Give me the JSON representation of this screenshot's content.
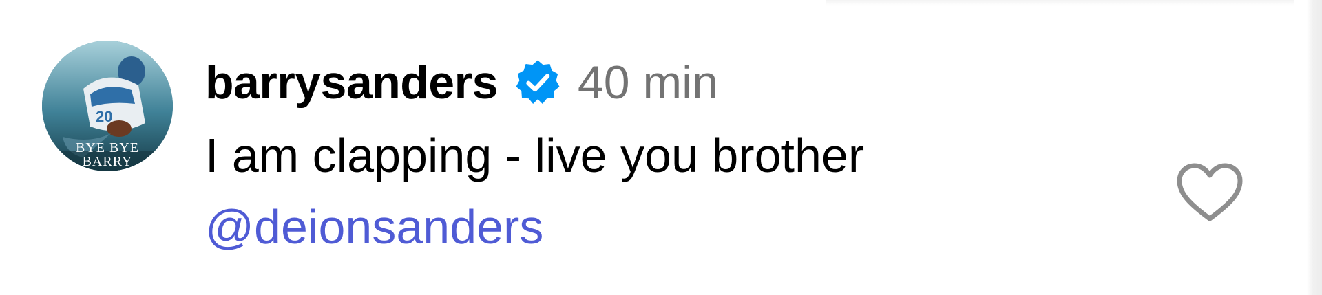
{
  "comment": {
    "avatar_caption": "BYE BYE BARRY",
    "username": "barrysanders",
    "verified_icon": "verified-badge-icon",
    "timestamp": "40 min",
    "text": "I am clapping - live you brother",
    "mention": "@deionsanders",
    "like_icon": "heart-outline-icon"
  },
  "colors": {
    "verified": "#0095f6",
    "mention": "#4f5bd5",
    "timestamp": "#737373",
    "heart": "#8e8e8e"
  }
}
